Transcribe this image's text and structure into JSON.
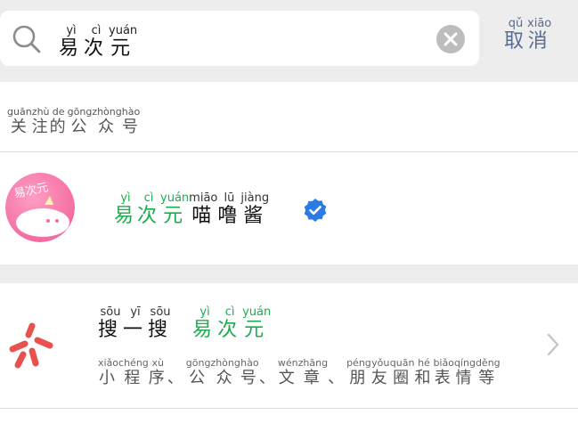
{
  "search": {
    "query": [
      {
        "char": "易",
        "pinyin": "yì"
      },
      {
        "char": "次",
        "pinyin": "cì"
      },
      {
        "char": "元",
        "pinyin": "yuán"
      }
    ],
    "cancel": [
      {
        "char": "取",
        "pinyin": "qǔ"
      },
      {
        "char": "消",
        "pinyin": "xiāo"
      }
    ]
  },
  "official_accounts": {
    "header": [
      {
        "char": "关",
        "pinyin": "guān"
      },
      {
        "char": "注",
        "pinyin": "zhù"
      },
      {
        "char": "的",
        "pinyin": "de"
      },
      {
        "char": "公",
        "pinyin": "gōng"
      },
      {
        "char": "众",
        "pinyin": "zhòng"
      },
      {
        "char": "号",
        "pinyin": "hào"
      }
    ],
    "account": {
      "name_highlight": [
        {
          "char": "易",
          "pinyin": "yì"
        },
        {
          "char": "次",
          "pinyin": "cì"
        },
        {
          "char": "元",
          "pinyin": "yuán"
        }
      ],
      "name_rest": [
        {
          "char": "喵",
          "pinyin": "miāo"
        },
        {
          "char": "噜",
          "pinyin": "lū"
        },
        {
          "char": "酱",
          "pinyin": "jiàng"
        }
      ],
      "avatar_text": "易次元",
      "verified_color": "#2a7be4"
    }
  },
  "sousou": {
    "title_prefix": [
      {
        "char": "搜",
        "pinyin": "sōu"
      },
      {
        "char": "一",
        "pinyin": "yī"
      },
      {
        "char": "搜",
        "pinyin": "sōu"
      }
    ],
    "title_highlight": [
      {
        "char": "易",
        "pinyin": "yì"
      },
      {
        "char": "次",
        "pinyin": "cì"
      },
      {
        "char": "元",
        "pinyin": "yuán"
      }
    ],
    "description": [
      {
        "char": "小",
        "pinyin": "xiǎo"
      },
      {
        "char": "程",
        "pinyin": "chéng"
      },
      {
        "char": "序",
        "pinyin": "xù"
      },
      {
        "char": "、",
        "pinyin": ""
      },
      {
        "char": "公",
        "pinyin": "gōng"
      },
      {
        "char": "众",
        "pinyin": "zhòng"
      },
      {
        "char": "号",
        "pinyin": "hào"
      },
      {
        "char": "、",
        "pinyin": ""
      },
      {
        "char": "文",
        "pinyin": "wén"
      },
      {
        "char": "章",
        "pinyin": "zhāng"
      },
      {
        "char": "、",
        "pinyin": ""
      },
      {
        "char": "朋",
        "pinyin": "péng"
      },
      {
        "char": "友",
        "pinyin": "yǒu"
      },
      {
        "char": "圈",
        "pinyin": "quān"
      },
      {
        "char": "和",
        "pinyin": "hé"
      },
      {
        "char": "表",
        "pinyin": "biǎo"
      },
      {
        "char": "情",
        "pinyin": "qíng"
      },
      {
        "char": "等",
        "pinyin": "děng"
      }
    ]
  },
  "colors": {
    "highlight": "#1aad4f",
    "link": "#576b95",
    "sousou_icon": "#e9514f"
  }
}
